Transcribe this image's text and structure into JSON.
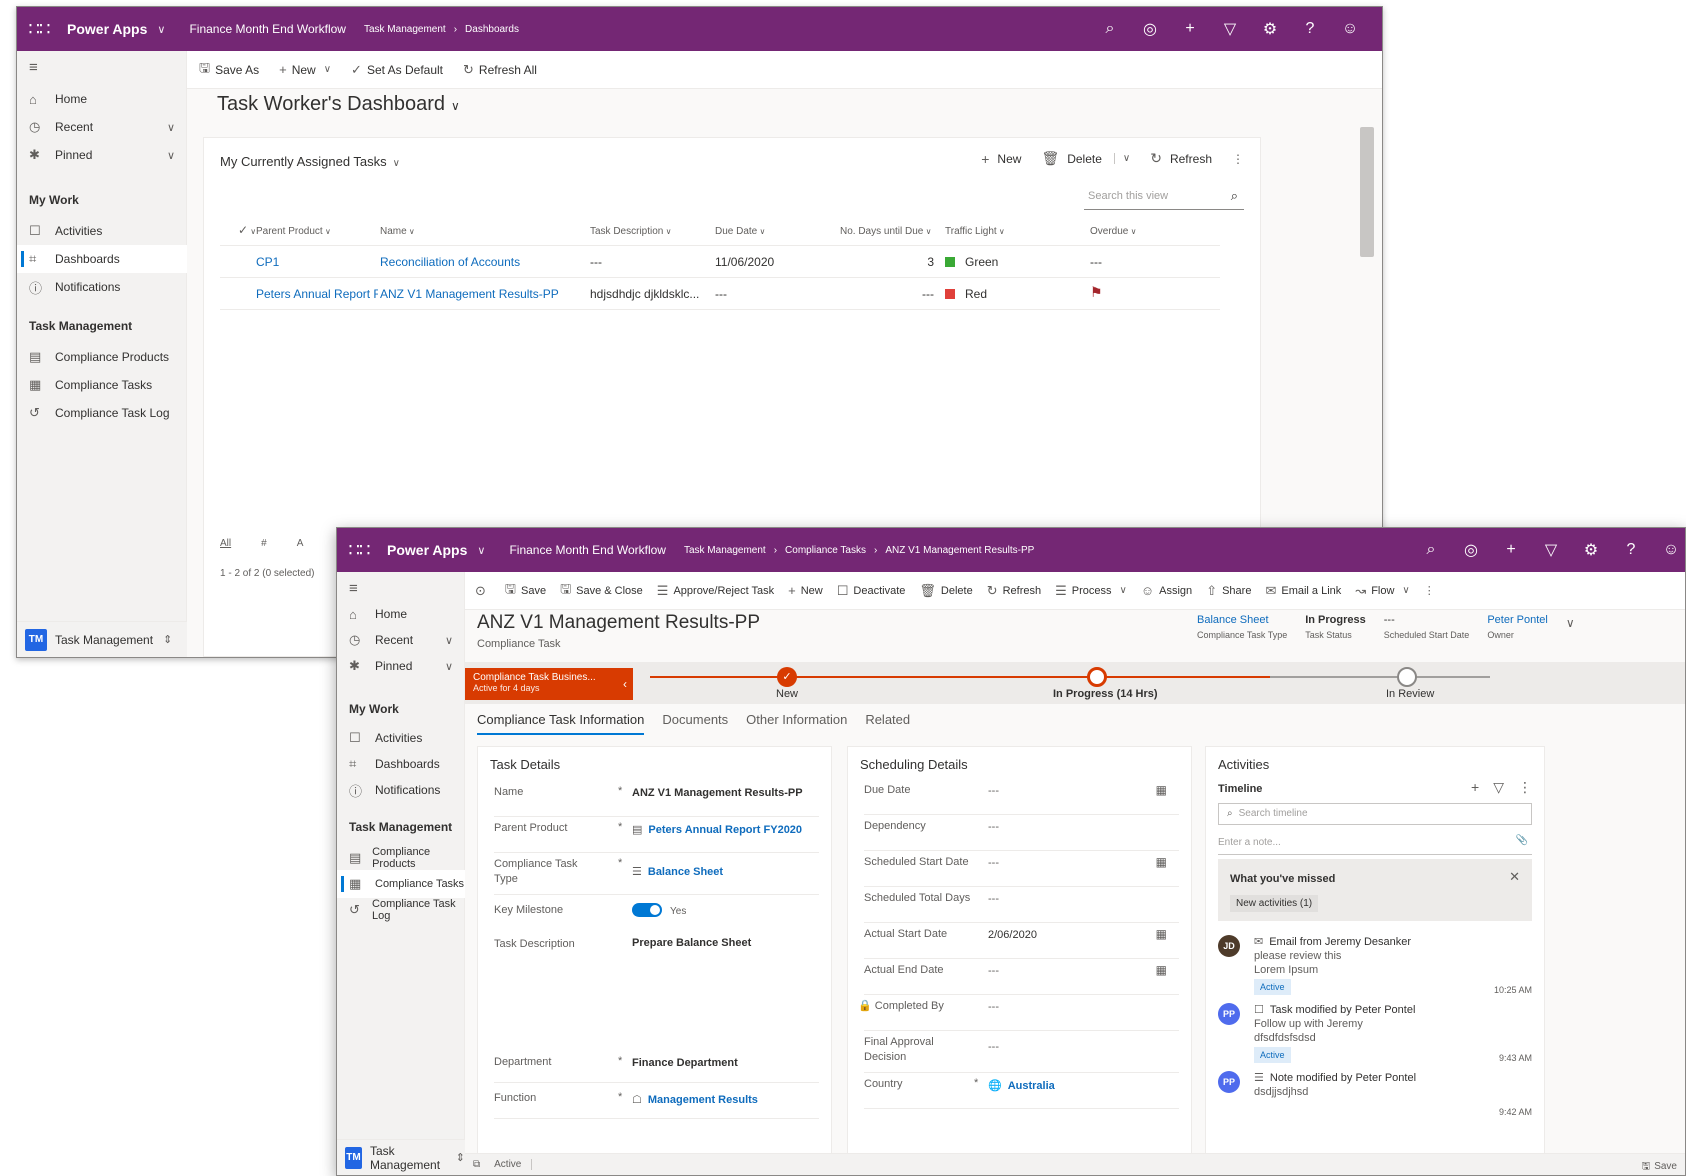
{
  "win1": {
    "appbar": {
      "app_name": "Power Apps",
      "environment": "Finance Month End Workflow",
      "crumbs": [
        "Task Management",
        "Dashboards"
      ],
      "icons": [
        "search-icon",
        "target-icon",
        "plus-icon",
        "filter-icon",
        "gear-icon",
        "help-icon",
        "person-icon"
      ]
    },
    "nav": {
      "home": "Home",
      "recent": "Recent",
      "pinned": "Pinned",
      "group_mywork": "My Work",
      "activities": "Activities",
      "dashboards": "Dashboards",
      "notifications": "Notifications",
      "group_taskmgmt": "Task Management",
      "compliance_products": "Compliance Products",
      "compliance_tasks": "Compliance Tasks",
      "compliance_task_log": "Compliance Task Log",
      "area_badge": "TM",
      "area_name": "Task Management"
    },
    "cmdbar": {
      "save_as": "Save As",
      "new": "New",
      "set_as_default": "Set As Default",
      "refresh_all": "Refresh All"
    },
    "dashboard_title": "Task Worker's Dashboard",
    "view": {
      "title": "My Currently Assigned Tasks",
      "new": "New",
      "delete": "Delete",
      "refresh": "Refresh",
      "search_placeholder": "Search this view",
      "columns": [
        "Parent Product",
        "Name",
        "Task Description",
        "Due Date",
        "No. Days until Due",
        "Traffic Light",
        "Overdue"
      ],
      "rows": [
        {
          "parent": "CP1",
          "name": "Reconciliation of Accounts",
          "desc": "---",
          "due": "11/06/2020",
          "days": "3",
          "light": "Green",
          "light_color": "#3aa935",
          "overdue": "---",
          "flag": false
        },
        {
          "parent": "Peters Annual Report FY.",
          "name": "ANZ V1 Management Results-PP",
          "desc": "hdjsdhdjc djkldsklc...",
          "due": "---",
          "days": "---",
          "light": "Red",
          "light_color": "#e0403a",
          "overdue": "",
          "flag": true
        }
      ],
      "jump_all": "All",
      "jump_hash": "#",
      "jump_a": "A",
      "footer": "1 - 2 of 2 (0 selected)"
    }
  },
  "win2": {
    "appbar": {
      "app_name": "Power Apps",
      "environment": "Finance Month End Workflow",
      "crumbs": [
        "Task Management",
        "Compliance Tasks",
        "ANZ V1 Management Results-PP"
      ]
    },
    "cmdbar": {
      "save": "Save",
      "save_close": "Save & Close",
      "approve_reject": "Approve/Reject Task",
      "new": "New",
      "deactivate": "Deactivate",
      "delete": "Delete",
      "refresh": "Refresh",
      "process": "Process",
      "assign": "Assign",
      "share": "Share",
      "email_link": "Email a Link",
      "flow": "Flow"
    },
    "record": {
      "title": "ANZ V1 Management Results-PP",
      "entity": "Compliance Task",
      "header_fields": [
        {
          "value": "Balance Sheet",
          "label": "Compliance Task Type"
        },
        {
          "value": "In Progress",
          "label": "Task Status"
        },
        {
          "value": "---",
          "label": "Scheduled Start Date"
        },
        {
          "value": "Peter Pontel",
          "label": "Owner"
        }
      ]
    },
    "bpf": {
      "active_stage": "Compliance Task Busines...",
      "active_for": "Active for 4 days",
      "stages": [
        "New",
        "In Progress  (14 Hrs)",
        "In Review"
      ]
    },
    "tabs": [
      "Compliance Task Information",
      "Documents",
      "Other Information",
      "Related"
    ],
    "task_details": {
      "title": "Task Details",
      "name_label": "Name",
      "name_value": "ANZ V1 Management Results-PP",
      "parent_label": "Parent Product",
      "parent_value": "Peters Annual Report FY2020",
      "type_label": "Compliance Task Type",
      "type_value": "Balance Sheet",
      "milestone_label": "Key Milestone",
      "milestone_value": "Yes",
      "desc_label": "Task Description",
      "desc_value": "Prepare Balance Sheet",
      "dept_label": "Department",
      "dept_value": "Finance Department",
      "function_label": "Function",
      "function_value": "Management Results"
    },
    "scheduling": {
      "title": "Scheduling Details",
      "due_label": "Due Date",
      "due_value": "---",
      "dep_label": "Dependency",
      "dep_value": "---",
      "sched_start_label": "Scheduled Start Date",
      "sched_start_value": "---",
      "sched_days_label": "Scheduled Total Days",
      "sched_days_value": "---",
      "actual_start_label": "Actual Start Date",
      "actual_start_value": "2/06/2020",
      "actual_end_label": "Actual End Date",
      "actual_end_value": "---",
      "completed_label": "Completed By",
      "completed_value": "---",
      "final_label": "Final Approval Decision",
      "final_value": "---",
      "country_label": "Country",
      "country_value": "Australia"
    },
    "activities": {
      "title": "Activities",
      "timeline": "Timeline",
      "search_placeholder": "Search timeline",
      "note_placeholder": "Enter a note...",
      "missed_title": "What you've missed",
      "missed_badge": "New activities (1)",
      "items": [
        {
          "avatar": "JD",
          "color": "#4e3b2a",
          "title": "Email from Jeremy Desanker",
          "lines": [
            "please review this",
            "Lorem Ipsum"
          ],
          "badge": "Active",
          "time": "10:25 AM"
        },
        {
          "avatar": "PP",
          "color": "#4f6bed",
          "title": "Task modified by Peter Pontel",
          "lines": [
            "Follow up with Jeremy",
            "dfsdfdsfsdsd"
          ],
          "badge": "Active",
          "time": "9:43 AM"
        },
        {
          "avatar": "PP",
          "color": "#4f6bed",
          "title": "Note modified by Peter Pontel",
          "lines": [
            "dsdjjsdjhsd"
          ],
          "badge": "",
          "time": "9:42 AM"
        }
      ]
    },
    "statusbar": {
      "status": "Active",
      "save": "Save"
    }
  }
}
